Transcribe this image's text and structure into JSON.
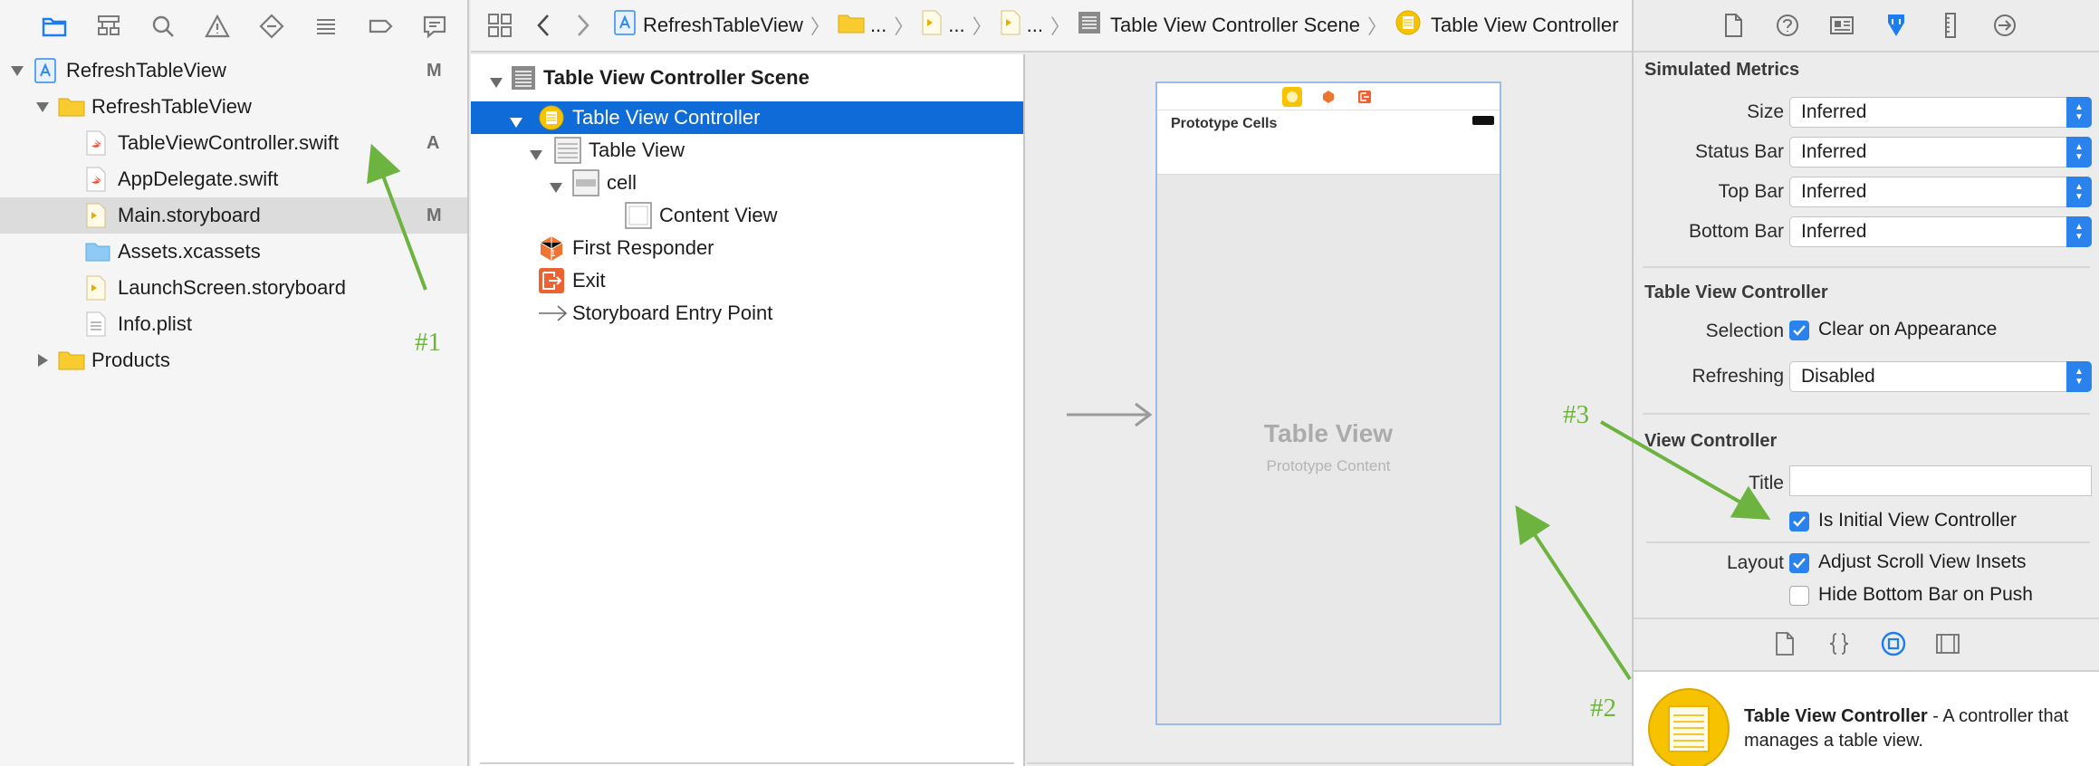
{
  "navigator": {
    "toolbar_icons": [
      "folder-icon",
      "hierarchy-icon",
      "search-icon",
      "warning-icon",
      "test-icon",
      "debug-icon",
      "breakpoint-icon",
      "report-icon"
    ],
    "items": [
      {
        "name": "RefreshTableView",
        "badge": "M",
        "icon": "project-icon"
      },
      {
        "name": "RefreshTableView",
        "badge": "",
        "icon": "folder-icon"
      },
      {
        "name": "TableViewController.swift",
        "badge": "A",
        "icon": "swift-file-icon"
      },
      {
        "name": "AppDelegate.swift",
        "badge": "",
        "icon": "swift-file-icon"
      },
      {
        "name": "Main.storyboard",
        "badge": "M",
        "icon": "storyboard-icon"
      },
      {
        "name": "Assets.xcassets",
        "badge": "",
        "icon": "assets-icon"
      },
      {
        "name": "LaunchScreen.storyboard",
        "badge": "",
        "icon": "storyboard-icon"
      },
      {
        "name": "Info.plist",
        "badge": "",
        "icon": "plist-icon"
      },
      {
        "name": "Products",
        "badge": "",
        "icon": "folder-icon"
      }
    ]
  },
  "jumpbar": {
    "project": "RefreshTableView",
    "ellipsis": "...",
    "scene": "Table View Controller Scene",
    "controller": "Table View Controller"
  },
  "outline": {
    "items": [
      {
        "label": "Table View Controller Scene"
      },
      {
        "label": "Table View Controller"
      },
      {
        "label": "Table View"
      },
      {
        "label": "cell"
      },
      {
        "label": "Content View"
      },
      {
        "label": "First Responder"
      },
      {
        "label": "Exit"
      },
      {
        "label": "Storyboard Entry Point"
      }
    ]
  },
  "canvas": {
    "prototype_cells": "Prototype Cells",
    "table_view_title": "Table View",
    "table_view_subtitle": "Prototype Content"
  },
  "inspector": {
    "simulated_metrics": {
      "title": "Simulated Metrics",
      "fields": [
        {
          "label": "Size",
          "value": "Inferred"
        },
        {
          "label": "Status Bar",
          "value": "Inferred"
        },
        {
          "label": "Top Bar",
          "value": "Inferred"
        },
        {
          "label": "Bottom Bar",
          "value": "Inferred"
        }
      ]
    },
    "table_view_controller": {
      "title": "Table View Controller",
      "selection_label": "Selection",
      "clear_on_appearance": "Clear on Appearance",
      "refreshing_label": "Refreshing",
      "refreshing_value": "Disabled"
    },
    "view_controller": {
      "title": "View Controller",
      "title_label": "Title",
      "title_value": "",
      "is_initial": "Is Initial View Controller",
      "layout_label": "Layout",
      "adjust_scroll": "Adjust Scroll View Insets",
      "hide_bottom_bar": "Hide Bottom Bar on Push"
    },
    "library": {
      "item_name": "Table View Controller",
      "item_desc": "- A controller that manages a table view."
    }
  },
  "annotations": {
    "label1": "#1",
    "label2": "#2",
    "label3": "#3",
    "color": "#6db33f"
  }
}
